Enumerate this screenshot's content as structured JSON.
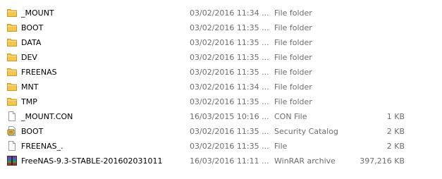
{
  "files": [
    {
      "icon": "folder-icon",
      "name": "_MOUNT",
      "date": "03/02/2016 11:34 ...",
      "type": "File folder",
      "size": ""
    },
    {
      "icon": "folder-icon",
      "name": "BOOT",
      "date": "03/02/2016 11:35 ...",
      "type": "File folder",
      "size": ""
    },
    {
      "icon": "folder-icon",
      "name": "DATA",
      "date": "03/02/2016 11:35 ...",
      "type": "File folder",
      "size": ""
    },
    {
      "icon": "folder-icon",
      "name": "DEV",
      "date": "03/02/2016 11:35 ...",
      "type": "File folder",
      "size": ""
    },
    {
      "icon": "folder-icon",
      "name": "FREENAS",
      "date": "03/02/2016 11:35 ...",
      "type": "File folder",
      "size": ""
    },
    {
      "icon": "folder-icon",
      "name": "MNT",
      "date": "03/02/2016 11:34 ...",
      "type": "File folder",
      "size": ""
    },
    {
      "icon": "folder-icon",
      "name": "TMP",
      "date": "03/02/2016 11:35 ...",
      "type": "File folder",
      "size": ""
    },
    {
      "icon": "blank-file-icon",
      "name": "_MOUNT.CON",
      "date": "16/03/2015 10:16 ...",
      "type": "CON File",
      "size": "1 KB"
    },
    {
      "icon": "security-catalog-icon",
      "name": "BOOT",
      "date": "03/02/2016 11:35 ...",
      "type": "Security Catalog",
      "size": "2 KB"
    },
    {
      "icon": "blank-file-icon",
      "name": "FREENAS_.",
      "date": "03/02/2016 11:35 ...",
      "type": "File",
      "size": "2 KB"
    },
    {
      "icon": "winrar-archive-icon",
      "name": "FreeNAS-9.3-STABLE-201602031011",
      "date": "16/03/2016 11:11 ...",
      "type": "WinRAR archive",
      "size": "397,216 KB"
    }
  ],
  "colors": {
    "folder_fill": "#f3c64e",
    "folder_border": "#c9982a",
    "secondary_text": "#6d6d6d"
  }
}
